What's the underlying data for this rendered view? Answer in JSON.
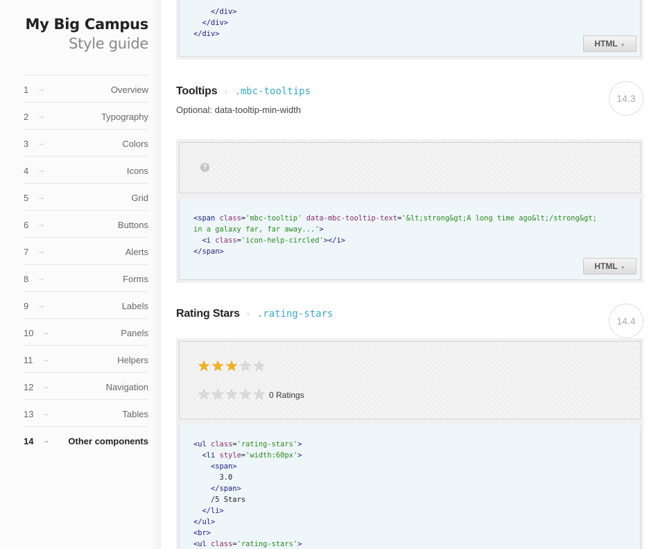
{
  "brand": {
    "title": "My Big Campus",
    "subtitle": "Style guide"
  },
  "nav": [
    {
      "num": "1",
      "label": "Overview"
    },
    {
      "num": "2",
      "label": "Typography"
    },
    {
      "num": "3",
      "label": "Colors"
    },
    {
      "num": "4",
      "label": "Icons"
    },
    {
      "num": "5",
      "label": "Grid"
    },
    {
      "num": "6",
      "label": "Buttons"
    },
    {
      "num": "7",
      "label": "Alerts"
    },
    {
      "num": "8",
      "label": "Forms"
    },
    {
      "num": "9",
      "label": "Labels"
    },
    {
      "num": "10",
      "label": "Panels"
    },
    {
      "num": "11",
      "label": "Helpers"
    },
    {
      "num": "12",
      "label": "Navigation"
    },
    {
      "num": "13",
      "label": "Tables"
    },
    {
      "num": "14",
      "label": "Other components",
      "active": true
    }
  ],
  "icons": {
    "nav_arrow": "right-arrow-icon",
    "help": "help-circled-icon",
    "star": "star-icon",
    "html_caret": "caret-up-icon"
  },
  "colors": {
    "class_name": "#3fa7c9",
    "star_on": "#f2b01e",
    "star_off": "#d9d9d9",
    "code_bg": "#eef6fa"
  },
  "top_code": {
    "lines": [
      "    </div>",
      "  </div>",
      "</div>"
    ],
    "toggle_label": "HTML",
    "toggle_caret": "▲"
  },
  "tooltips": {
    "title": "Tooltips",
    "separator": "›",
    "class_name": ".mbc-tooltips",
    "description": "Optional: data-tooltip-min-width",
    "number": "14.3",
    "help_glyph": "?",
    "code": {
      "line1": {
        "open": "<span",
        "attr1": "class",
        "val1": "'mbc-tooltip'",
        "attr2": "data-mbc-tooltip-text",
        "val2": "'&lt;strong&gt;A long time ago&lt;/strong&gt;"
      },
      "line2": {
        "val": "in a galaxy far, far away...'",
        "close": ">"
      },
      "line3": {
        "open": "<i",
        "attr": "class",
        "val": "'icon-help-circled'",
        "close": "></i>"
      },
      "line4": {
        "close": "</span>"
      }
    },
    "toggle_label": "HTML",
    "toggle_caret": "▲"
  },
  "rating": {
    "title": "Rating Stars",
    "separator": "›",
    "class_name": ".rating-stars",
    "number": "14.4",
    "star_glyph": "★",
    "row1_value": 3,
    "row1_max": 5,
    "row2_value": 0,
    "row2_max": 5,
    "row2_label": "0 Ratings",
    "code": {
      "l1": {
        "open": "<ul",
        "attr": "class",
        "val": "'rating-stars'",
        "close": ">"
      },
      "l2": {
        "open": "<li",
        "attr": "style",
        "val_a": "'width:",
        "val_b": "60px",
        "val_c": "'",
        "close": ">"
      },
      "l3": "<span>",
      "l4": "3.0",
      "l5": "</span>",
      "l6": "/5 Stars",
      "l7": "</li>",
      "l8": "</ul>",
      "l9": "<br>",
      "l10": {
        "open": "<ul",
        "attr": "class",
        "val": "'rating-stars'",
        "close": ">"
      }
    }
  }
}
